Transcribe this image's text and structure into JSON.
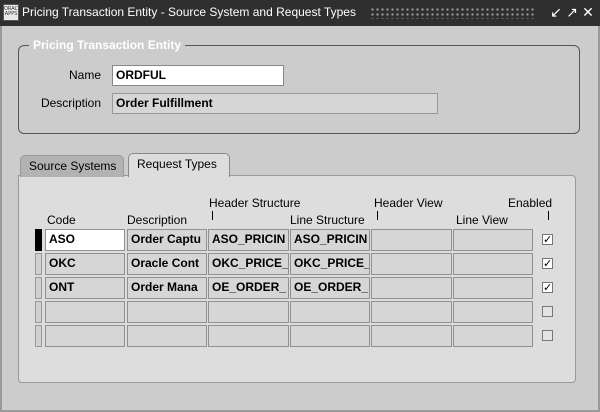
{
  "window": {
    "title": "Pricing Transaction Entity - Source System and Request Types",
    "icon_text": "ORACLE APPS",
    "controls": [
      "↙",
      "↗",
      "✕"
    ]
  },
  "group": {
    "legend": "Pricing Transaction Entity",
    "name_label": "Name",
    "name_value": "ORDFUL",
    "description_label": "Description",
    "description_value": "Order Fulfillment"
  },
  "tabs": [
    {
      "label": "Source Systems",
      "active": false
    },
    {
      "label": "Request Types",
      "active": true
    }
  ],
  "table": {
    "headers": {
      "code": "Code",
      "description": "Description",
      "header_structure": "Header Structure",
      "line_structure": "Line Structure",
      "header_view": "Header View",
      "line_view": "Line View",
      "enabled": "Enabled"
    },
    "rows": [
      {
        "code": "ASO",
        "description": "Order Captu",
        "header_structure": "ASO_PRICIN",
        "line_structure": "ASO_PRICIN",
        "header_view": "",
        "line_view": "",
        "enabled": "✓"
      },
      {
        "code": "OKC",
        "description": "Oracle Cont",
        "header_structure": "OKC_PRICE_",
        "line_structure": "OKC_PRICE_",
        "header_view": "",
        "line_view": "",
        "enabled": "✓"
      },
      {
        "code": "ONT",
        "description": "Order Mana",
        "header_structure": "OE_ORDER_",
        "line_structure": "OE_ORDER_",
        "header_view": "",
        "line_view": "",
        "enabled": "✓"
      },
      {
        "code": "",
        "description": "",
        "header_structure": "",
        "line_structure": "",
        "header_view": "",
        "line_view": "",
        "enabled": ""
      },
      {
        "code": "",
        "description": "",
        "header_structure": "",
        "line_structure": "",
        "header_view": "",
        "line_view": "",
        "enabled": ""
      }
    ]
  }
}
